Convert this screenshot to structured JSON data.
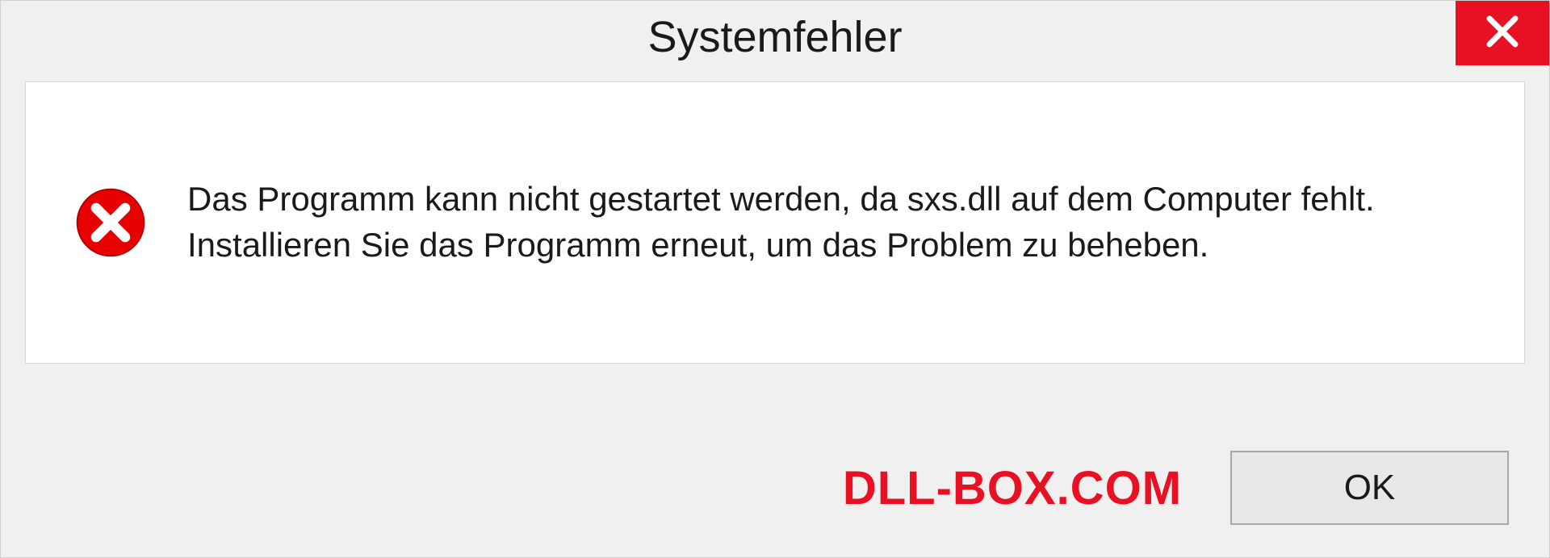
{
  "dialog": {
    "title": "Systemfehler",
    "message": "Das Programm kann nicht gestartet werden, da sxs.dll auf dem Computer fehlt. Installieren Sie das Programm erneut, um das Problem zu beheben.",
    "ok_label": "OK"
  },
  "watermark": "DLL-BOX.COM",
  "colors": {
    "close_bg": "#e81123",
    "error_icon": "#e60000",
    "watermark": "#e81123"
  }
}
